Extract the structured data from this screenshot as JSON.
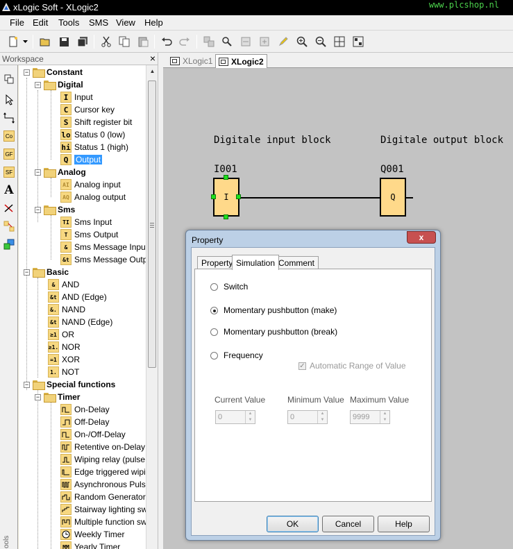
{
  "window": {
    "title": "xLogic Soft - XLogic2",
    "watermark": "www.plcshop.nl"
  },
  "menu": [
    "File",
    "Edit",
    "Tools",
    "SMS",
    "View",
    "Help"
  ],
  "workspace": {
    "title": "Workspace",
    "close": "×",
    "strip_label": "ools",
    "tree": {
      "constant": "Constant",
      "digital": "Digital",
      "digital_items": [
        "Input",
        "Cursor key",
        "Shift register bit",
        "Status 0 (low)",
        "Status 1 (high)",
        "Output"
      ],
      "digital_icons": [
        "I",
        "C",
        "S",
        "lo",
        "hi",
        "Q"
      ],
      "analog": "Analog",
      "analog_items": [
        "Analog input",
        "Analog output"
      ],
      "analog_icons": [
        "AI",
        "AQ"
      ],
      "sms": "Sms",
      "sms_items": [
        "Sms Input",
        "Sms Output",
        "Sms Message Input",
        "Sms Message Outp"
      ],
      "sms_icons": [
        "TI",
        "T",
        "&",
        "&t"
      ],
      "basic": "Basic",
      "basic_items": [
        "AND",
        "AND (Edge)",
        "NAND",
        "NAND (Edge)",
        "OR",
        "NOR",
        "XOR",
        "NOT"
      ],
      "basic_icons": [
        "&",
        "&t",
        "&.",
        "&t",
        "≥1",
        "≥1.",
        "=1",
        "1."
      ],
      "special": "Special functions",
      "timer": "Timer",
      "timer_items": [
        "On-Delay",
        "Off-Delay",
        "On-/Off-Delay",
        "Retentive on-Delay",
        "Wiping relay (pulse",
        "Edge triggered wipi",
        "Asynchronous Puls",
        "Random Generator",
        "Stairway lighting sw",
        "Multiple function sw",
        "Weekly Timer",
        "Yearly Timer"
      ]
    }
  },
  "doc_tabs": [
    "XLogic1",
    "XLogic2"
  ],
  "canvas": {
    "input_heading": "Digitale input block",
    "output_heading": "Digitale output block",
    "input_id": "I001",
    "input_symbol": "I",
    "output_id": "Q001",
    "output_symbol": "Q"
  },
  "dialog": {
    "title": "Property",
    "close": "x",
    "tabs": [
      "Property",
      "Simulation",
      "Comment"
    ],
    "options": [
      "Switch",
      "Momentary pushbutton (make)",
      "Momentary pushbutton (break)",
      "Frequency"
    ],
    "selected_option": "Momentary pushbutton (make)",
    "auto_range": "Automatic Range of Value",
    "auto_range_checked": true,
    "current_label": "Current Value",
    "current_value": "0",
    "min_label": "Minimum Value",
    "min_value": "0",
    "max_label": "Maximum Value",
    "max_value": "9999",
    "ok": "OK",
    "cancel": "Cancel",
    "help": "Help"
  },
  "colors": {
    "selection": "#3399ff",
    "block_fill": "#ffd98a",
    "handle": "#1ee01e",
    "canvas": "#c3c3c3",
    "watermark": "#4cd34c"
  }
}
